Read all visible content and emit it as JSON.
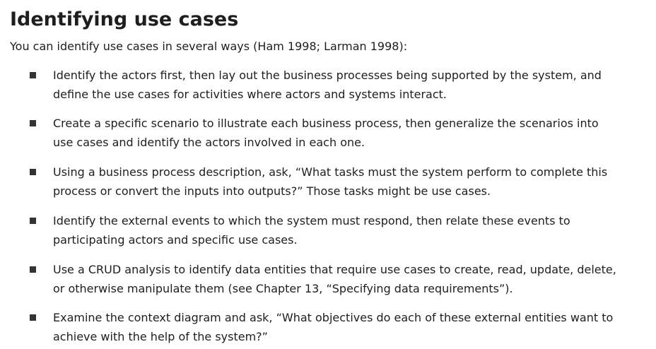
{
  "section": {
    "title": "Identifying use cases",
    "intro": "You can identify use cases in several ways (Ham 1998; Larman 1998):"
  },
  "bullets": [
    "Identify the actors first, then lay out the business processes being supported by the system, and define the use cases for activities where actors and systems interact.",
    "Create a specific scenario to illustrate each business process, then generalize the scenarios into use cases and identify the actors involved in each one.",
    "Using a business process description, ask, “What tasks must the system perform to complete this process or convert the inputs into outputs?” Those tasks might be use cases.",
    "Identify the external events to which the system must respond, then relate these events to participating actors and specific use cases.",
    "Use a CRUD analysis to identify data entities that require use cases to create, read, update, delete, or otherwise manipulate them (see Chapter 13, “Specifying data requirements”).",
    "Examine the context diagram and ask, “What objectives do each of these external entities want to achieve with the help of the system?”"
  ],
  "colors": {
    "text": "#1e1e1e",
    "bullet": "#333333",
    "background": "#ffffff"
  }
}
